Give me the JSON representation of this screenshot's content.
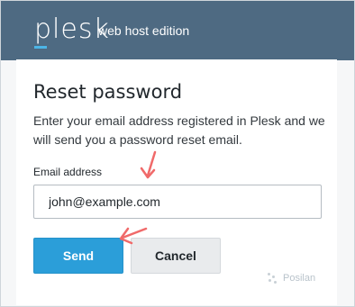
{
  "header": {
    "brand": "plesk",
    "edition": "web host edition"
  },
  "form": {
    "title": "Reset password",
    "description": "Enter your email address registered in Plesk and we will send you a password reset email.",
    "email_label": "Email address",
    "email_value": "john@example.com",
    "send_label": "Send",
    "cancel_label": "Cancel"
  },
  "watermark": {
    "text": "Posilan"
  },
  "colors": {
    "header_bg": "#4e6a82",
    "send_button": "#2b9ed9",
    "annotation_arrow": "#f06a6a"
  }
}
